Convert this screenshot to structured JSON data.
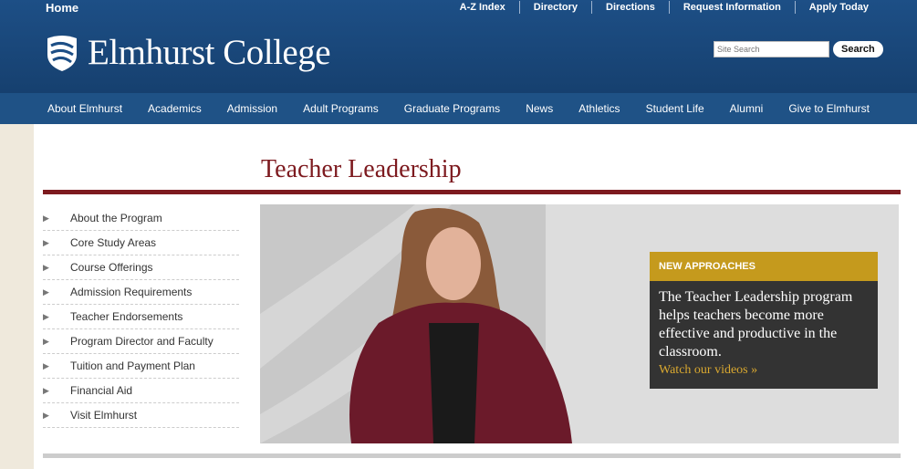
{
  "header": {
    "home": "Home",
    "top_links": [
      "A-Z Index",
      "Directory",
      "Directions",
      "Request Information",
      "Apply Today"
    ],
    "logo_text": "Elmhurst College",
    "search_placeholder": "Site Search",
    "search_button": "Search"
  },
  "nav": [
    "About Elmhurst",
    "Academics",
    "Admission",
    "Adult Programs",
    "Graduate Programs",
    "News",
    "Athletics",
    "Student Life",
    "Alumni",
    "Give to Elmhurst"
  ],
  "page": {
    "title": "Teacher Leadership"
  },
  "sidebar": [
    "About the Program",
    "Core Study Areas",
    "Course Offerings",
    "Admission Requirements",
    "Teacher Endorsements",
    "Program Director and Faculty",
    "Tuition and Payment Plan",
    "Financial Aid",
    "Visit Elmhurst"
  ],
  "promo": {
    "heading": "NEW APPROACHES",
    "text": "The Teacher Leadership program helps teachers become more effective and productive in the classroom.",
    "link": "Watch our videos »"
  },
  "colors": {
    "header_blue": "#1d4f86",
    "maroon": "#7d1a1f",
    "gold": "#c59a1d",
    "dark_panel": "#333333"
  }
}
